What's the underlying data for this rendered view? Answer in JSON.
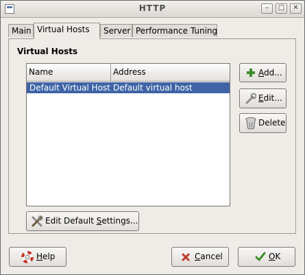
{
  "window": {
    "title": "HTTP"
  },
  "tabs": [
    {
      "label": "Main"
    },
    {
      "label": "Virtual Hosts"
    },
    {
      "label": "Server"
    },
    {
      "label": "Performance Tuning"
    }
  ],
  "section": {
    "title": "Virtual Hosts"
  },
  "table": {
    "columns": [
      "Name",
      "Address"
    ],
    "rows": [
      {
        "name": "Default Virtual Host",
        "address": "Default virtual host"
      }
    ]
  },
  "buttons": {
    "add": {
      "mnemonic": "A",
      "rest": "dd..."
    },
    "edit": {
      "mnemonic": "E",
      "rest": "dit..."
    },
    "delete": {
      "label": "Delete"
    },
    "edit_default": {
      "prefix": "Edit Default ",
      "mnemonic": "S",
      "rest": "ettings..."
    },
    "help": {
      "mnemonic": "H",
      "rest": "elp"
    },
    "cancel": {
      "mnemonic": "C",
      "rest": "ancel"
    },
    "ok": {
      "mnemonic": "O",
      "rest": "K"
    }
  },
  "colors": {
    "selection": "#3f64a6",
    "window_bg": "#efebe7"
  }
}
